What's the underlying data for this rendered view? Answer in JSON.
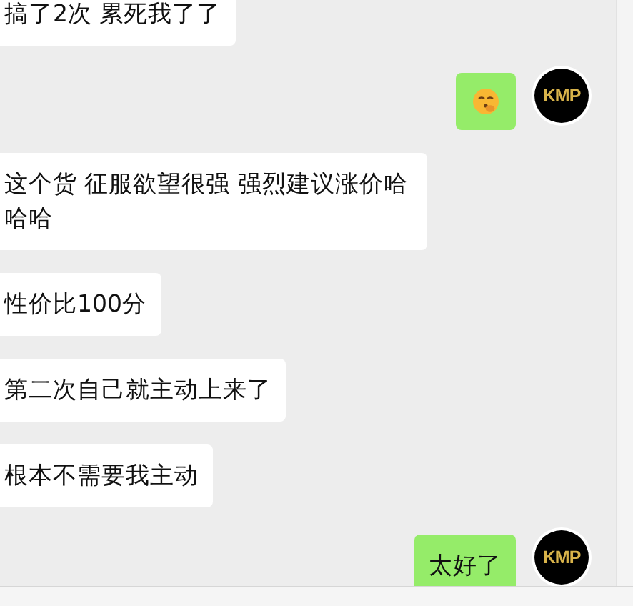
{
  "messages": [
    {
      "outgoing": false,
      "kind": "text",
      "text": "搞了2次 累死我了了"
    },
    {
      "outgoing": true,
      "kind": "emoji",
      "avatar": "KMP"
    },
    {
      "outgoing": false,
      "kind": "text",
      "text": "这个货 征服欲望很强 强烈建议涨价哈哈哈"
    },
    {
      "outgoing": false,
      "kind": "text",
      "text": "性价比100分"
    },
    {
      "outgoing": false,
      "kind": "text",
      "text": "第二次自己就主动上来了"
    },
    {
      "outgoing": false,
      "kind": "text",
      "text": "根本不需要我主动"
    },
    {
      "outgoing": true,
      "kind": "text",
      "text": "太好了",
      "avatar": "KMP"
    }
  ]
}
